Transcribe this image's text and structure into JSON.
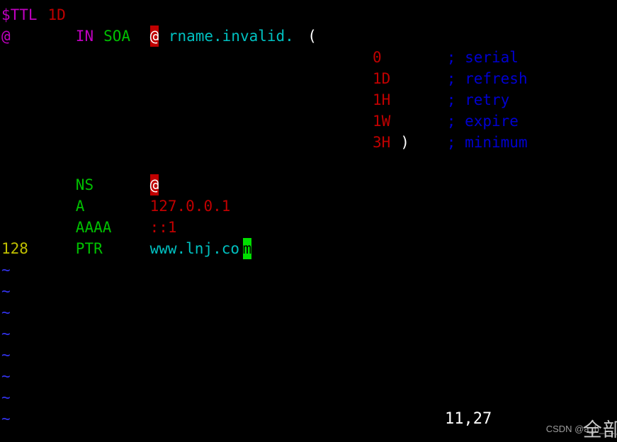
{
  "app": {
    "name": "vim",
    "mode": "normal",
    "background": "#000000",
    "cursor_position": "11,27"
  },
  "colors": {
    "directive": "#c000c0",
    "number": "#c00000",
    "keyword": "#c000c0",
    "rrtype": "#00c000",
    "string": "#00c0c0",
    "paren": "#ffffff",
    "comment": "#0000d0",
    "label": "#c0c000",
    "tilde": "#3333ee",
    "error_bg": "#c00000",
    "cursor_bg": "#00e000"
  },
  "buffer": {
    "lines": [
      {
        "n": 1,
        "tokens": [
          {
            "text": "$TTL",
            "cls": "c-directive",
            "col": 0
          },
          {
            "text": "1D",
            "cls": "c-number",
            "col": 5
          }
        ]
      },
      {
        "n": 2,
        "tokens": [
          {
            "text": "@",
            "cls": "c-at",
            "col": 0
          },
          {
            "text": "IN",
            "cls": "c-keyword",
            "col": 8
          },
          {
            "text": "SOA",
            "cls": "c-type",
            "col": 11
          },
          {
            "text": "@",
            "cls": "c-error",
            "col": 16
          },
          {
            "text": "rname.invalid.",
            "cls": "c-string",
            "col": 18
          },
          {
            "text": "(",
            "cls": "c-paren",
            "col": 33
          }
        ]
      },
      {
        "n": 3,
        "tokens": [
          {
            "text": "0",
            "cls": "c-number",
            "col": 40
          },
          {
            "text": "; serial",
            "cls": "c-comment",
            "col": 48
          }
        ]
      },
      {
        "n": 4,
        "tokens": [
          {
            "text": "1D",
            "cls": "c-number",
            "col": 40
          },
          {
            "text": "; refresh",
            "cls": "c-comment",
            "col": 48
          }
        ]
      },
      {
        "n": 5,
        "tokens": [
          {
            "text": "1H",
            "cls": "c-number",
            "col": 40
          },
          {
            "text": "; retry",
            "cls": "c-comment",
            "col": 48
          }
        ]
      },
      {
        "n": 6,
        "tokens": [
          {
            "text": "1W",
            "cls": "c-number",
            "col": 40
          },
          {
            "text": "; expire",
            "cls": "c-comment",
            "col": 48
          }
        ]
      },
      {
        "n": 7,
        "tokens": [
          {
            "text": "3H",
            "cls": "c-number",
            "col": 40
          },
          {
            "text": ")",
            "cls": "c-paren",
            "col": 43
          },
          {
            "text": "; minimum",
            "cls": "c-comment",
            "col": 48
          }
        ]
      },
      {
        "n": 8,
        "tokens": []
      },
      {
        "n": 9,
        "tokens": [
          {
            "text": "NS",
            "cls": "c-type",
            "col": 8
          },
          {
            "text": "@",
            "cls": "c-error",
            "col": 16
          }
        ]
      },
      {
        "n": 10,
        "tokens": [
          {
            "text": "A",
            "cls": "c-type",
            "col": 8
          },
          {
            "text": "127.0.0.1",
            "cls": "c-number",
            "col": 16
          }
        ]
      },
      {
        "n": 11,
        "tokens": [
          {
            "text": "AAAA",
            "cls": "c-type",
            "col": 8
          },
          {
            "text": "::1",
            "cls": "c-number",
            "col": 16
          }
        ]
      },
      {
        "n": 12,
        "tokens": [
          {
            "text": "128",
            "cls": "c-label",
            "col": 0
          },
          {
            "text": "PTR",
            "cls": "c-type",
            "col": 8
          },
          {
            "text": "www.lnj.co",
            "cls": "c-string",
            "col": 16
          },
          {
            "text": "m",
            "cls": "c-cursor",
            "col": 26
          }
        ]
      }
    ],
    "filler_char": "~",
    "filler_count": 8
  },
  "status": {
    "ruler": "11,27"
  },
  "watermark": {
    "text": "CSDN @a_b_c_",
    "overlay": "全部"
  }
}
